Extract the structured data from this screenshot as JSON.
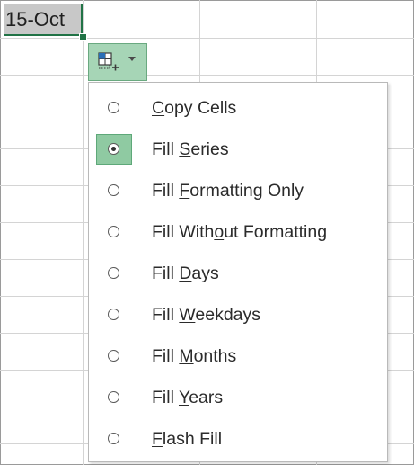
{
  "cell": {
    "value": "15-Oct"
  },
  "autofill_button": {
    "icon": "autofill-options-icon",
    "dropdown_icon": "chevron-down-icon"
  },
  "menu": {
    "selected_index": 1,
    "items": [
      {
        "pre": "",
        "key": "C",
        "post": "opy Cells",
        "label": "Copy Cells"
      },
      {
        "pre": "Fill ",
        "key": "S",
        "post": "eries",
        "label": "Fill Series"
      },
      {
        "pre": "Fill ",
        "key": "F",
        "post": "ormatting Only",
        "label": "Fill Formatting Only"
      },
      {
        "pre": "Fill With",
        "key": "o",
        "post": "ut Formatting",
        "label": "Fill Without Formatting"
      },
      {
        "pre": "Fill ",
        "key": "D",
        "post": "ays",
        "label": "Fill Days"
      },
      {
        "pre": "Fill ",
        "key": "W",
        "post": "eekdays",
        "label": "Fill Weekdays"
      },
      {
        "pre": "Fill ",
        "key": "M",
        "post": "onths",
        "label": "Fill Months"
      },
      {
        "pre": "Fill ",
        "key": "Y",
        "post": "ears",
        "label": "Fill Years"
      },
      {
        "pre": "",
        "key": "F",
        "post": "lash Fill",
        "label": "Flash Fill"
      }
    ]
  },
  "colors": {
    "excel_green": "#217346",
    "selection_fill": "#c8c8c8",
    "radio_highlight": "#8fcaa2",
    "button_highlight": "#a6d5b6"
  }
}
